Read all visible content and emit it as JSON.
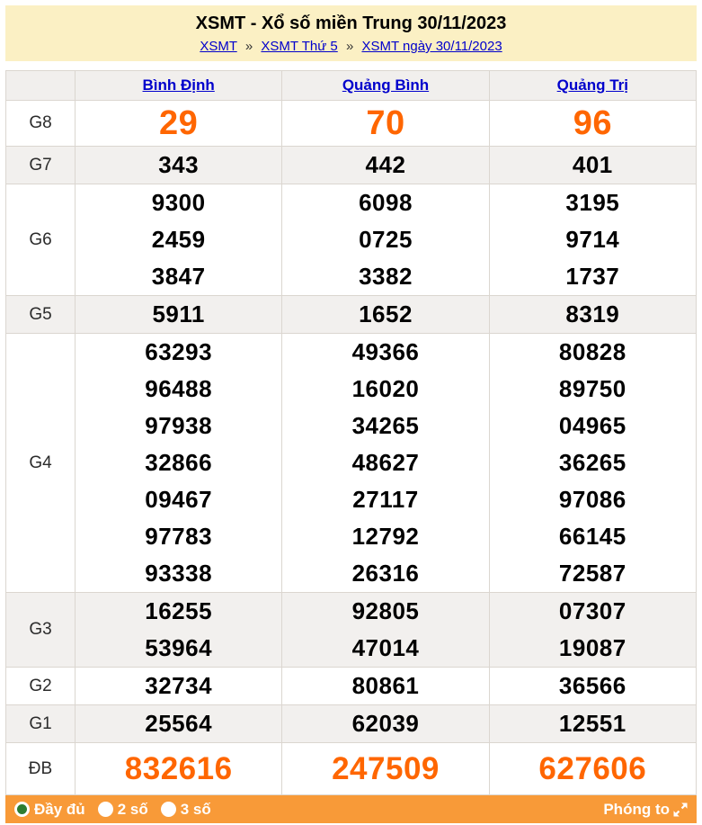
{
  "header": {
    "title": "XSMT - Xổ số miền Trung 30/11/2023",
    "breadcrumb_separator": "»",
    "breadcrumb": [
      {
        "label": "XSMT"
      },
      {
        "label": "XSMT Thứ 5"
      },
      {
        "label": "XSMT ngày 30/11/2023"
      }
    ]
  },
  "table": {
    "columns": [
      "Bình Định",
      "Quảng Bình",
      "Quảng Trị"
    ],
    "rows": [
      {
        "prize": "G8",
        "highlight": true,
        "values": [
          [
            "29"
          ],
          [
            "70"
          ],
          [
            "96"
          ]
        ]
      },
      {
        "prize": "G7",
        "highlight": false,
        "values": [
          [
            "343"
          ],
          [
            "442"
          ],
          [
            "401"
          ]
        ]
      },
      {
        "prize": "G6",
        "highlight": false,
        "values": [
          [
            "9300",
            "2459",
            "3847"
          ],
          [
            "6098",
            "0725",
            "3382"
          ],
          [
            "3195",
            "9714",
            "1737"
          ]
        ]
      },
      {
        "prize": "G5",
        "highlight": false,
        "values": [
          [
            "5911"
          ],
          [
            "1652"
          ],
          [
            "8319"
          ]
        ]
      },
      {
        "prize": "G4",
        "highlight": false,
        "values": [
          [
            "63293",
            "96488",
            "97938",
            "32866",
            "09467",
            "97783",
            "93338"
          ],
          [
            "49366",
            "16020",
            "34265",
            "48627",
            "27117",
            "12792",
            "26316"
          ],
          [
            "80828",
            "89750",
            "04965",
            "36265",
            "97086",
            "66145",
            "72587"
          ]
        ]
      },
      {
        "prize": "G3",
        "highlight": false,
        "values": [
          [
            "16255",
            "53964"
          ],
          [
            "92805",
            "47014"
          ],
          [
            "07307",
            "19087"
          ]
        ]
      },
      {
        "prize": "G2",
        "highlight": false,
        "values": [
          [
            "32734"
          ],
          [
            "80861"
          ],
          [
            "36566"
          ]
        ]
      },
      {
        "prize": "G1",
        "highlight": false,
        "values": [
          [
            "25564"
          ],
          [
            "62039"
          ],
          [
            "12551"
          ]
        ]
      },
      {
        "prize": "ĐB",
        "highlight": true,
        "values": [
          [
            "832616"
          ],
          [
            "247509"
          ],
          [
            "627606"
          ]
        ]
      }
    ]
  },
  "footer": {
    "options": [
      {
        "label": "Đầy đủ",
        "selected": true
      },
      {
        "label": "2 số",
        "selected": false
      },
      {
        "label": "3 số",
        "selected": false
      }
    ],
    "zoom_label": "Phóng to",
    "zoom_icon": "expand-icon"
  },
  "colors": {
    "banner_bg": "#FBF0C4",
    "footer_bg": "#F89A38",
    "highlight_number": "#FF6600",
    "link": "#0000CC",
    "row_alt_bg": "#F2F0EE",
    "radio_selected_dot": "#2E7D32"
  }
}
